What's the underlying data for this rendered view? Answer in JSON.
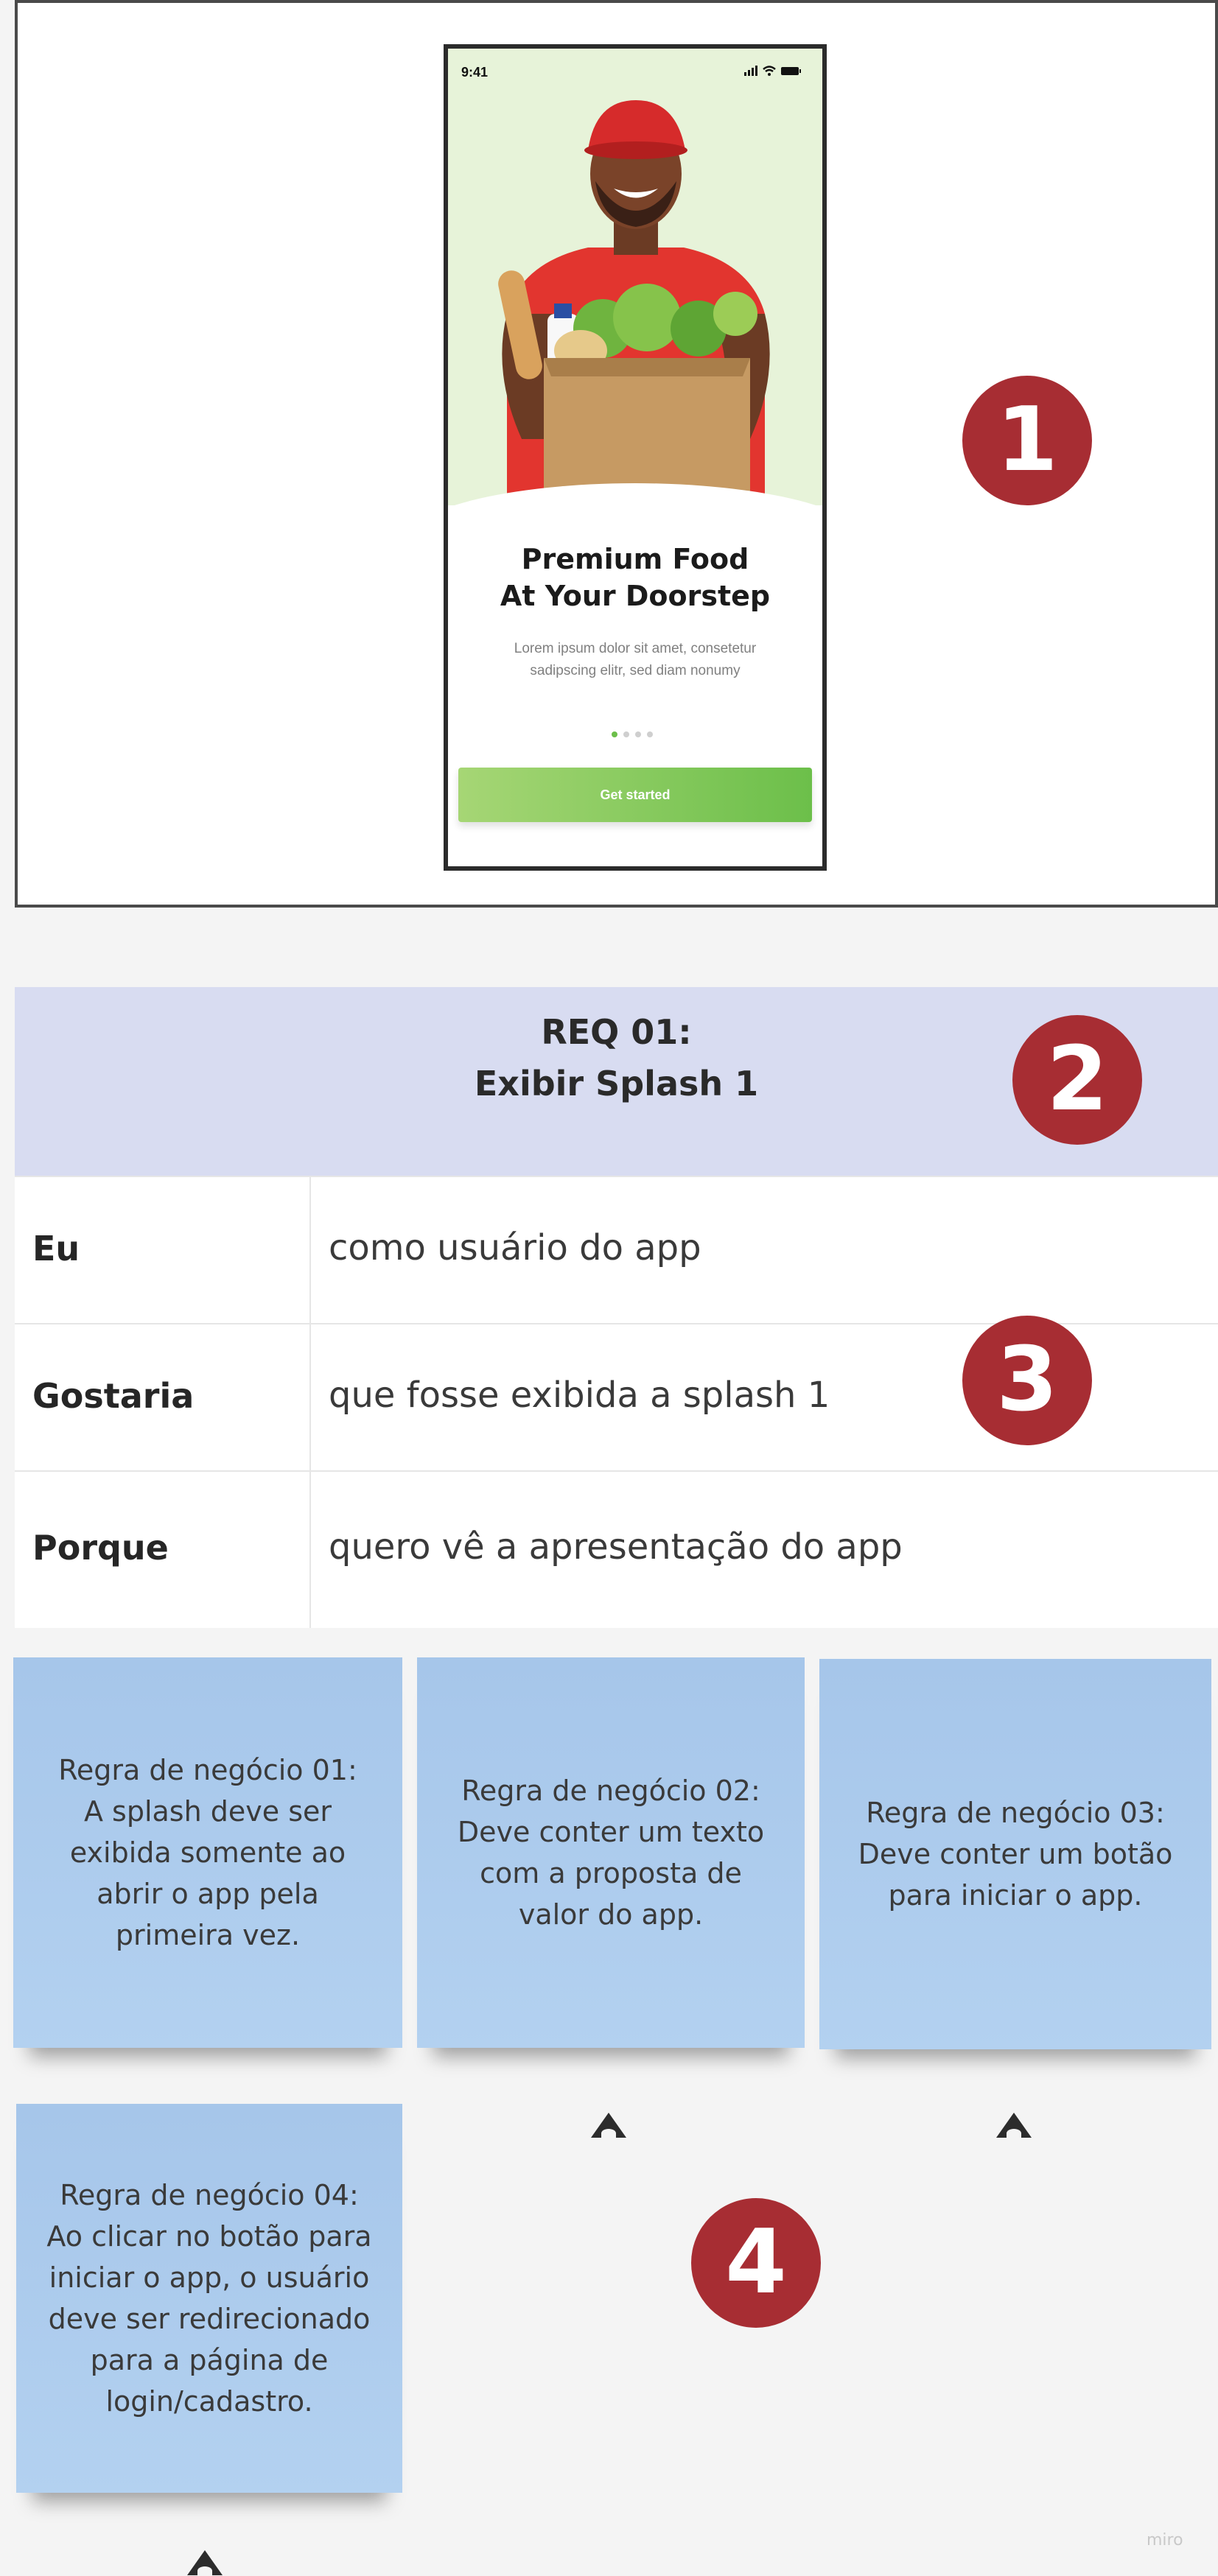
{
  "mockup": {
    "status_time": "9:41",
    "title_line1": "Premium Food",
    "title_line2": "At Your Doorstep",
    "description_line1": "Lorem ipsum dolor sit amet, consetetur",
    "description_line2": "sadipscing elitr, sed diam nonumy",
    "cta_label": "Get started",
    "pager": {
      "count": 4,
      "active_index": 0
    },
    "colors": {
      "hero_bg": "#e7f3d9",
      "accent": "#6cbf4a",
      "shirt": "#e2352f"
    }
  },
  "badges": [
    "1",
    "2",
    "3",
    "4"
  ],
  "requirement": {
    "id": "REQ 01:",
    "title": "Exibir Splash 1",
    "rows": [
      {
        "label": "Eu",
        "value": "como usuário do app"
      },
      {
        "label": "Gostaria",
        "value": "que fosse exibida a splash 1"
      },
      {
        "label": "Porque",
        "value": "quero vê a apresentação do app"
      }
    ]
  },
  "notes": [
    {
      "lines": [
        "Regra de negócio 01:",
        "A splash deve ser",
        "exibida somente ao",
        "abrir o app pela",
        "primeira vez."
      ]
    },
    {
      "lines": [
        "Regra de negócio 02:",
        "Deve conter um texto",
        "com a proposta de",
        "valor do app."
      ]
    },
    {
      "lines": [
        "Regra de negócio 03:",
        "Deve conter um botão",
        "para iniciar o app."
      ]
    },
    {
      "lines": [
        "Regra de negócio 04:",
        "Ao clicar no botão para",
        "iniciar o app, o usuário",
        "deve ser redirecionado",
        "para a página de",
        "login/cadastro."
      ]
    }
  ],
  "brand": "miro",
  "icons": [
    "signal-icon",
    "wifi-icon",
    "battery-icon",
    "cursor-arrow-icon"
  ]
}
